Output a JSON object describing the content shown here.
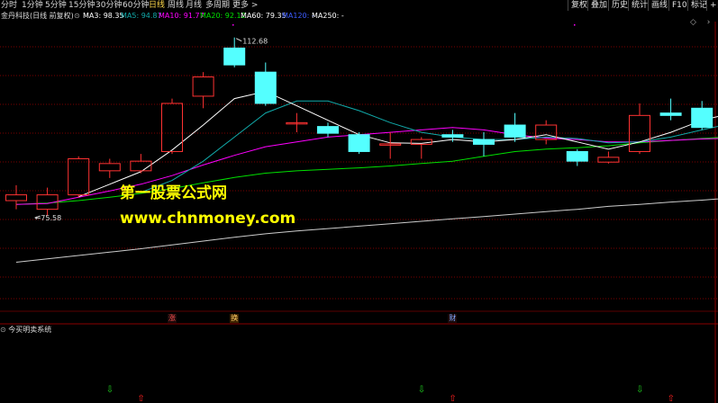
{
  "toolbar": {
    "left": [
      "分时",
      "1分钟",
      "5分钟",
      "15分钟",
      "30分钟",
      "60分钟",
      "日线",
      "周线",
      "月线",
      "多周期",
      "更多 >"
    ],
    "active_index": 6,
    "right": [
      "复权",
      "叠加",
      "历史",
      "统计",
      "画线",
      "F10",
      "标记",
      "+自"
    ]
  },
  "info": {
    "stock_name": "金丹科技(日线 前复权)",
    "ma3": "MA3: 98.35",
    "ma5": "MA5: 94.87",
    "ma10": "MA10: 91.77",
    "ma20": "MA20: 92.12",
    "ma60": "MA60: 79.35",
    "ma120": "MA120: -",
    "ma250": "MA250: -"
  },
  "colors": {
    "up": "#ff3232",
    "down": "#54ffff",
    "ma3": "#ffffff",
    "ma5": "#11aaaa",
    "ma10": "#ff00ff",
    "ma20": "#00e000",
    "ma60": "#cccccc",
    "grid": "#7a0000",
    "buy": "#ff2020",
    "sell": "#20d020"
  },
  "chart_data": {
    "type": "candlestick",
    "high_label": "112.68",
    "low_label": "75.58",
    "candles": [
      {
        "o": 78.8,
        "c": 80.0,
        "h": 82.0,
        "l": 77.0
      },
      {
        "o": 77.0,
        "c": 80.0,
        "h": 81.5,
        "l": 75.6
      },
      {
        "o": 80.0,
        "c": 87.5,
        "h": 88.0,
        "l": 79.5
      },
      {
        "o": 85.0,
        "c": 86.5,
        "h": 87.5,
        "l": 83.5
      },
      {
        "o": 85.0,
        "c": 87.0,
        "h": 88.5,
        "l": 84.5
      },
      {
        "o": 89.0,
        "c": 99.0,
        "h": 100.0,
        "l": 88.5
      },
      {
        "o": 100.5,
        "c": 104.5,
        "h": 105.5,
        "l": 98.0
      },
      {
        "o": 110.5,
        "c": 107.0,
        "h": 112.7,
        "l": 106.5
      },
      {
        "o": 105.5,
        "c": 99.0,
        "h": 107.5,
        "l": 98.5
      },
      {
        "o": 95.0,
        "c": 95.0,
        "h": 97.0,
        "l": 93.0
      },
      {
        "o": 94.2,
        "c": 92.8,
        "h": 95.0,
        "l": 92.0
      },
      {
        "o": 92.5,
        "c": 89.0,
        "h": 93.0,
        "l": 88.5
      },
      {
        "o": 90.5,
        "c": 90.6,
        "h": 93.0,
        "l": 87.5
      },
      {
        "o": 90.5,
        "c": 91.5,
        "h": 92.0,
        "l": 87.5
      },
      {
        "o": 92.5,
        "c": 92.0,
        "h": 93.5,
        "l": 91.0
      },
      {
        "o": 91.5,
        "c": 90.5,
        "h": 93.0,
        "l": 88.0
      },
      {
        "o": 94.5,
        "c": 92.0,
        "h": 97.0,
        "l": 91.0
      },
      {
        "o": 91.5,
        "c": 94.5,
        "h": 95.5,
        "l": 90.5
      },
      {
        "o": 89.0,
        "c": 87.0,
        "h": 89.5,
        "l": 86.0
      },
      {
        "o": 86.8,
        "c": 87.8,
        "h": 89.0,
        "l": 86.5
      },
      {
        "o": 89.0,
        "c": 96.5,
        "h": 99.0,
        "l": 88.5
      },
      {
        "o": 97.0,
        "c": 96.5,
        "h": 100.0,
        "l": 95.5
      },
      {
        "o": 98.0,
        "c": 94.0,
        "h": 99.5,
        "l": 93.5
      },
      {
        "o": 93.0,
        "c": 102.5,
        "h": 103.0,
        "l": 92.5
      }
    ],
    "ma3": [
      null,
      null,
      79.6,
      82.2,
      84.8,
      89.3,
      94.5,
      100.0,
      101.5,
      98.5,
      95.5,
      92.5,
      90.8,
      90.7,
      91.5,
      91.0,
      91.5,
      92.5,
      91.0,
      89.5,
      91.0,
      93.0,
      95.5,
      97.0
    ],
    "ma5": [
      null,
      null,
      null,
      null,
      80.5,
      83.0,
      87.0,
      92.0,
      97.0,
      99.5,
      99.5,
      97.5,
      95.0,
      93.0,
      92.0,
      91.5,
      91.5,
      92.0,
      91.7,
      90.8,
      91.0,
      92.0,
      93.5,
      94.9
    ],
    "ma10": [
      78.0,
      78.2,
      79.5,
      80.8,
      82.2,
      84.0,
      86.2,
      88.2,
      90.0,
      91.0,
      92.0,
      92.5,
      93.0,
      93.5,
      94.0,
      93.5,
      92.5,
      91.8,
      91.5,
      91.0,
      91.0,
      91.3,
      91.6,
      91.8
    ],
    "ma20": [
      78.0,
      78.3,
      78.8,
      79.5,
      80.3,
      81.3,
      82.5,
      83.6,
      84.5,
      85.0,
      85.3,
      85.6,
      86.0,
      86.5,
      87.0,
      88.0,
      89.0,
      89.5,
      89.8,
      90.2,
      90.8,
      91.3,
      91.7,
      92.1
    ],
    "ma60": [
      66.0,
      66.7,
      67.4,
      68.1,
      68.8,
      69.6,
      70.4,
      71.2,
      71.9,
      72.5,
      73.0,
      73.5,
      74.0,
      74.5,
      75.0,
      75.5,
      76.0,
      76.5,
      77.0,
      77.6,
      78.0,
      78.5,
      78.9,
      79.4
    ],
    "events": [
      {
        "label": "涨",
        "index": 5
      },
      {
        "label": "换",
        "index": 7
      },
      {
        "label": "财",
        "index": 14
      }
    ],
    "signals": [
      {
        "type": "sell",
        "index": 3
      },
      {
        "type": "buy",
        "index": 4
      },
      {
        "type": "sell",
        "index": 13
      },
      {
        "type": "buy",
        "index": 14
      },
      {
        "type": "sell",
        "index": 20
      },
      {
        "type": "buy",
        "index": 21
      }
    ]
  },
  "watermark": {
    "line1": "第一股票公式网",
    "line2": "www.chnmoney.com"
  },
  "subchart": {
    "title": "今买明卖系统"
  }
}
